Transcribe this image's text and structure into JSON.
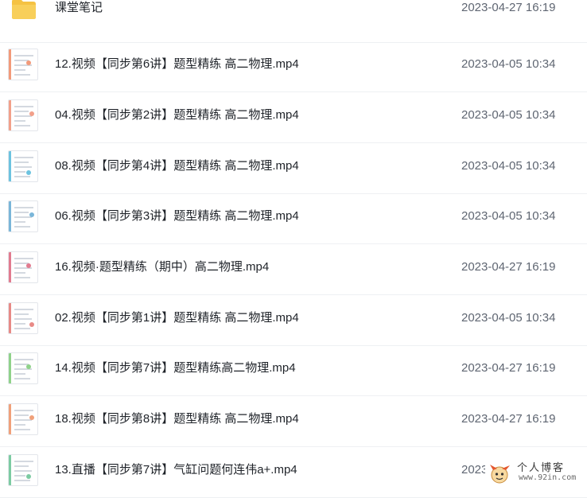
{
  "files": [
    {
      "name": "课堂笔记",
      "time": "2023-04-27 16:19",
      "type": "folder"
    },
    {
      "name": "12.视频【同步第6讲】题型精练 高二物理.mp4",
      "time": "2023-04-05 10:34",
      "type": "video",
      "accent": "#f29a7a"
    },
    {
      "name": "04.视频【同步第2讲】题型精练 高二物理.mp4",
      "time": "2023-04-05 10:34",
      "type": "video",
      "accent": "#f2a08a"
    },
    {
      "name": "08.视频【同步第4讲】题型精练 高二物理.mp4",
      "time": "2023-04-05 10:34",
      "type": "video",
      "accent": "#6cc3e0"
    },
    {
      "name": "06.视频【同步第3讲】题型精练 高二物理.mp4",
      "time": "2023-04-05 10:34",
      "type": "video",
      "accent": "#7ab6d9"
    },
    {
      "name": "16.视频·题型精练（期中）高二物理.mp4",
      "time": "2023-04-27 16:19",
      "type": "video",
      "accent": "#e27b8f"
    },
    {
      "name": "02.视频【同步第1讲】题型精练 高二物理.mp4",
      "time": "2023-04-05 10:34",
      "type": "video",
      "accent": "#e88a86"
    },
    {
      "name": "14.视频【同步第7讲】题型精练高二物理.mp4",
      "time": "2023-04-27 16:19",
      "type": "video",
      "accent": "#8fd28a"
    },
    {
      "name": "18.视频【同步第8讲】题型精练 高二物理.mp4",
      "time": "2023-04-27 16:19",
      "type": "video",
      "accent": "#f0a07a"
    },
    {
      "name": "13.直播【同步第7讲】气缸问题何连伟a+.mp4",
      "time": "2023-04-27 16:19",
      "type": "video",
      "accent": "#7ccba2"
    }
  ],
  "watermark": {
    "title": "个人博客",
    "url": "www.92in.com"
  },
  "colors": {
    "folder": "#f5c243",
    "divider": "#eef0f3",
    "text": "#1f2329",
    "time_text": "#5f6672"
  },
  "icons": {
    "folder": "folder-icon",
    "video": "video-thumbnail-icon",
    "mascot": "mascot-logo"
  }
}
